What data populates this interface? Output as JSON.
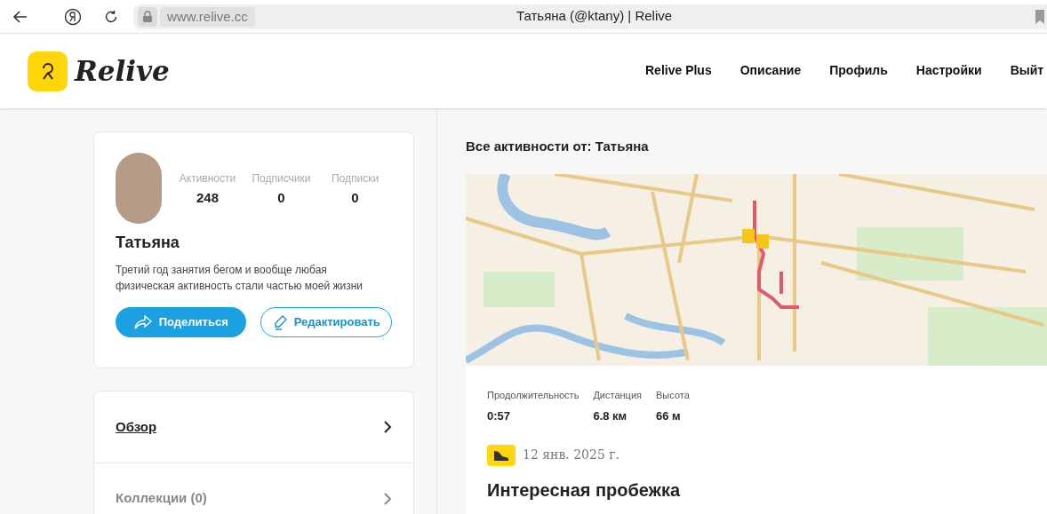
{
  "browser": {
    "url": "www.relive.cc",
    "title": "Татьяна (@ktany) | Relive"
  },
  "header": {
    "logo_text": "Relive",
    "nav": [
      "Relive Plus",
      "Описание",
      "Профиль",
      "Настройки",
      "Выйт"
    ]
  },
  "profile": {
    "name": "Татьяна",
    "bio": "Третий год занятия бегом и вообще любая физическая активность стали частью моей жизни",
    "stats": [
      {
        "label": "Активности",
        "value": "248"
      },
      {
        "label": "Подписчики",
        "value": "0"
      },
      {
        "label": "Подписки",
        "value": "0"
      }
    ],
    "share_button": "Поделиться",
    "edit_button": "Редактировать"
  },
  "menu": [
    {
      "label": "Обзор",
      "selected": true
    },
    {
      "label": "Коллекции (0)",
      "selected": false
    }
  ],
  "feed": {
    "heading": "Все активности от: Татьяна",
    "activity": {
      "stats": [
        {
          "label": "Продолжительность",
          "value": "0:57"
        },
        {
          "label": "Дистанция",
          "value": "6.8 км"
        },
        {
          "label": "Высота",
          "value": "66 м"
        }
      ],
      "date": "12 янв. 2025 г.",
      "title": "Интересная пробежка"
    }
  }
}
